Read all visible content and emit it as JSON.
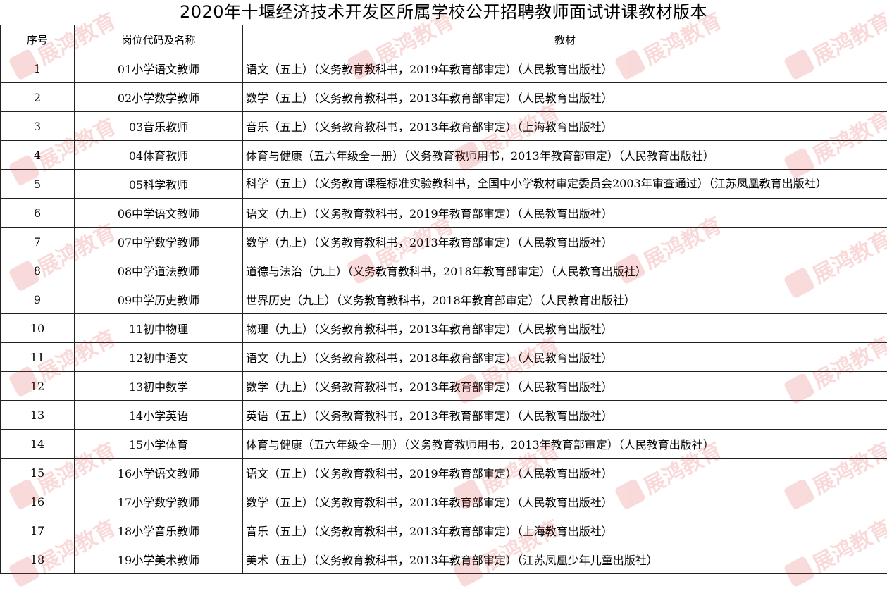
{
  "title": "2020年十堰经济技术开发区所属学校公开招聘教师面试讲课教材版本",
  "headers": {
    "index": "序号",
    "position": "岗位代码及名称",
    "textbook": "教材"
  },
  "rows": [
    {
      "index": "1",
      "position": "01小学语文教师",
      "textbook": "语文（五上）（义务教育教科书，2019年教育部审定）（人民教育出版社）"
    },
    {
      "index": "2",
      "position": "02小学数学教师",
      "textbook": "数学（五上）（义务教育教科书，2013年教育部审定）（人民教育出版社）"
    },
    {
      "index": "3",
      "position": "03音乐教师",
      "textbook": "音乐（五上）（义务教育教科书，2013年教育部审定）（上海教育出版社）"
    },
    {
      "index": "4",
      "position": "04体育教师",
      "textbook": "体育与健康（五六年级全一册）（义务教育教师用书，2013年教育部审定）（人民教育出版社）"
    },
    {
      "index": "5",
      "position": "05科学教师",
      "textbook": "科学（五上）（义务教育课程标准实验教科书，全国中小学教材审定委员会2003年审查通过）（江苏凤凰教育出版社）"
    },
    {
      "index": "6",
      "position": "06中学语文教师",
      "textbook": "语文（九上）（义务教育教科书，2019年教育部审定）（人民教育出版社）"
    },
    {
      "index": "7",
      "position": "07中学数学教师",
      "textbook": "数学（九上）（义务教育教科书，2013年教育部审定）（人民教育出版社）"
    },
    {
      "index": "8",
      "position": "08中学道法教师",
      "textbook": "道德与法治（九上）（义务教育教科书，2018年教育部审定）（人民教育出版社）"
    },
    {
      "index": "9",
      "position": "09中学历史教师",
      "textbook": "世界历史（九上）（义务教育教科书，2018年教育部审定）（人民教育出版社）"
    },
    {
      "index": "10",
      "position": "11初中物理",
      "textbook": "物理（九上）（义务教育教科书，2013年教育部审定）（人民教育出版社）"
    },
    {
      "index": "11",
      "position": "12初中语文",
      "textbook": "语文（九上）（义务教育教科书，2018年教育部审定）（人民教育出版社）"
    },
    {
      "index": "12",
      "position": "13初中数学",
      "textbook": "数学（九上）（义务教育教科书，2013年教育部审定）（人民教育出版社）"
    },
    {
      "index": "13",
      "position": "14小学英语",
      "textbook": "英语（五上）（义务教育教科书，2013年教育部审定）（人民教育出版社）"
    },
    {
      "index": "14",
      "position": "15小学体育",
      "textbook": "体育与健康（五六年级全一册）（义务教育教师用书，2013年教育部审定）（人民教育出版社）"
    },
    {
      "index": "15",
      "position": "16小学语文教师",
      "textbook": "语文（五上）（义务教育教科书，2019年教育部审定）（人民教育出版社）"
    },
    {
      "index": "16",
      "position": "17小学数学教师",
      "textbook": "数学（五上）（义务教育教科书，2013年教育部审定）（人民教育出版社）"
    },
    {
      "index": "17",
      "position": "18小学音乐教师",
      "textbook": "音乐（五上）（义务教育教科书，2013年教育部审定）（上海教育出版社）"
    },
    {
      "index": "18",
      "position": "19小学美术教师",
      "textbook": "美术（五上）（义务教育教科书，2013年教育部审定）（江苏凤凰少年儿童出版社）"
    }
  ],
  "watermark": {
    "brand": "展鸿教育",
    "color": "#e02020"
  }
}
